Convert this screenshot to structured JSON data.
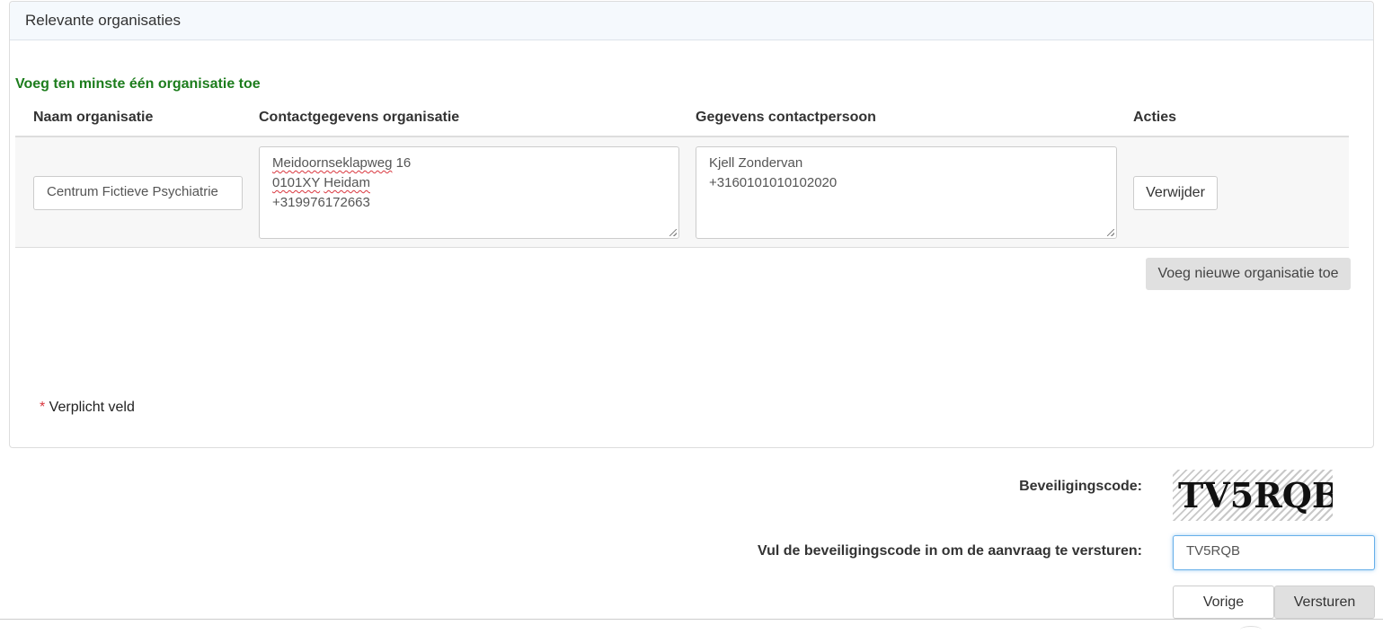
{
  "panel": {
    "title": "Relevante organisaties",
    "hint": "Voeg ten minste één organisatie toe",
    "columns": [
      "Naam organisatie",
      "Contactgegevens organisatie",
      "Gegevens contactpersoon",
      "Acties"
    ],
    "rows": [
      {
        "name": "Centrum Fictieve Psychiatrie",
        "contact_lines": [
          {
            "spell": "Meidoornseklapweg",
            "rest": " 16"
          },
          {
            "spell": "0101XY",
            "mid": " ",
            "spell2": "Heidam"
          },
          {
            "plain": "+319976172663"
          }
        ],
        "person_lines": [
          "Kjell Zondervan",
          "+3160101010102020"
        ],
        "remove_label": "Verwijder"
      }
    ],
    "add_label": "Voeg nieuwe organisatie toe",
    "required_star": "*",
    "required_text": " Verplicht veld"
  },
  "security": {
    "code_label": "Beveiligingscode:",
    "captcha_text": "TV5RQB",
    "input_label": "Vul de beveiligingscode in om de aanvraag te versturen:",
    "input_value": "TV5RQB"
  },
  "nav": {
    "prev_label": "Vorige",
    "submit_label": "Versturen"
  }
}
